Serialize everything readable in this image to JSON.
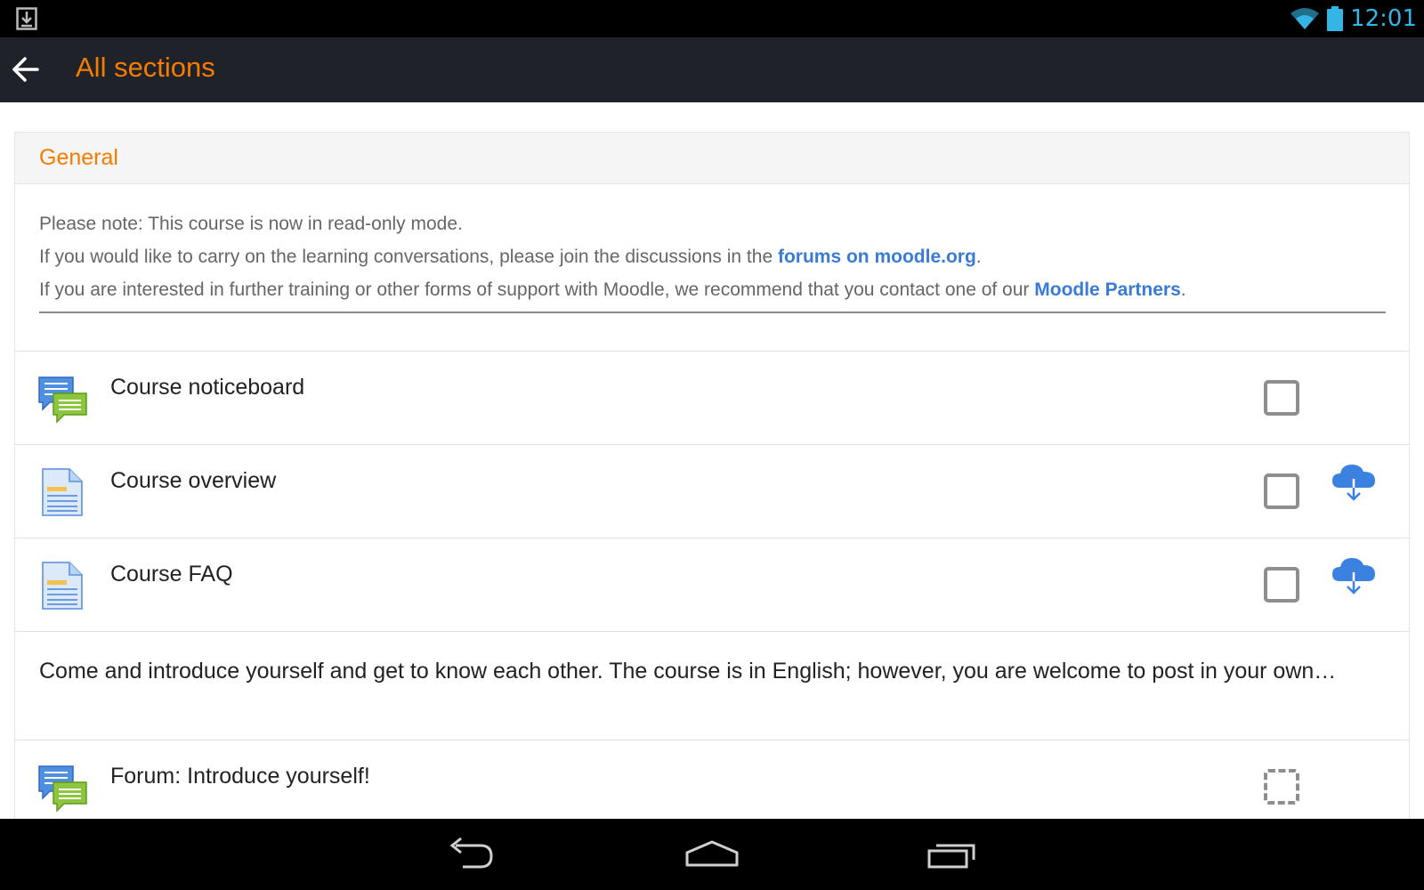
{
  "status_bar": {
    "time": "12:01",
    "icons": [
      "download-notification-icon",
      "wifi-icon",
      "battery-icon"
    ],
    "time_color": "#33b5e5"
  },
  "action_bar": {
    "title": "All sections",
    "back_icon": "back-arrow-icon",
    "title_color": "#f57c00",
    "background": "#1f2329"
  },
  "section": {
    "title": "General",
    "summary": {
      "line1": "Please note: This course is now in read-only mode.",
      "line2_before": "If you would like to carry on the learning conversations, please join the discussions in the ",
      "line2_link": "forums on moodle.org",
      "line2_after": ".",
      "line3_before": "If you are interested in further training or other forms of support with Moodle, we recommend that you contact one of our ",
      "line3_link": "Moodle Partners",
      "line3_after": "."
    },
    "link_color": "#3a7bd5"
  },
  "modules": [
    {
      "label": "Course noticeboard",
      "icon": "forum-icon",
      "completion": "unchecked",
      "download": false
    },
    {
      "label": "Course overview",
      "icon": "page-icon",
      "completion": "unchecked",
      "download": true
    },
    {
      "label": "Course FAQ",
      "icon": "page-icon",
      "completion": "unchecked",
      "download": true
    }
  ],
  "description": "Come and introduce yourself and get to know each other. The course is in English; however, you are welcome to post in your own…",
  "forum": {
    "label": "Forum: Introduce yourself!",
    "icon": "forum-icon",
    "completion": "auto"
  },
  "nav_bar": {
    "buttons": [
      "back-nav-icon",
      "home-nav-icon",
      "recents-nav-icon"
    ]
  }
}
